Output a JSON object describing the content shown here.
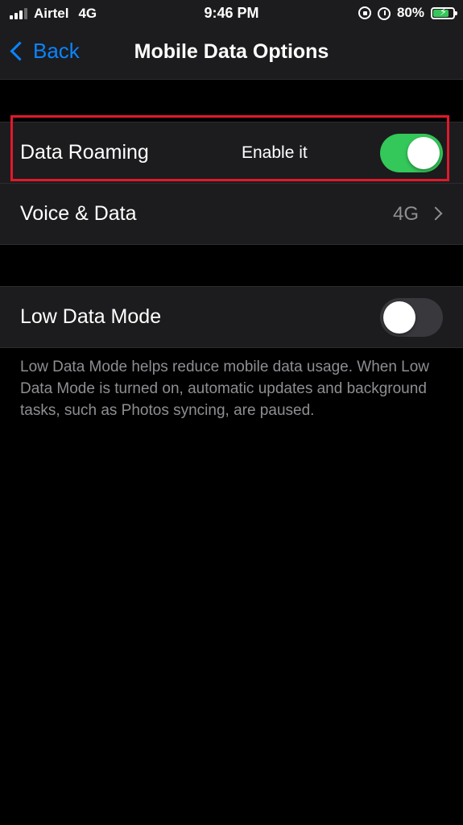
{
  "status_bar": {
    "carrier": "Airtel",
    "network": "4G",
    "time": "9:46 PM",
    "battery": "80%",
    "battery_level": 0.8,
    "icons": [
      "signal-icon",
      "orientation-lock-icon",
      "alarm-icon",
      "battery-charging-icon"
    ]
  },
  "nav": {
    "back_label": "Back",
    "title": "Mobile Data Options"
  },
  "section1": {
    "data_roaming": {
      "label": "Data Roaming",
      "annotation": "Enable it",
      "toggle_on": true
    },
    "voice_data": {
      "label": "Voice & Data",
      "value": "4G"
    }
  },
  "section2": {
    "low_data_mode": {
      "label": "Low Data Mode",
      "toggle_on": false
    },
    "footer": "Low Data Mode helps reduce mobile data usage. When Low Data Mode is turned on, automatic updates and background tasks, such as Photos syncing, are paused."
  },
  "colors": {
    "accent": "#0a84ff",
    "toggle_on": "#34c759",
    "highlight": "#e0192b",
    "background": "#000000",
    "cell": "#1c1c1e"
  }
}
